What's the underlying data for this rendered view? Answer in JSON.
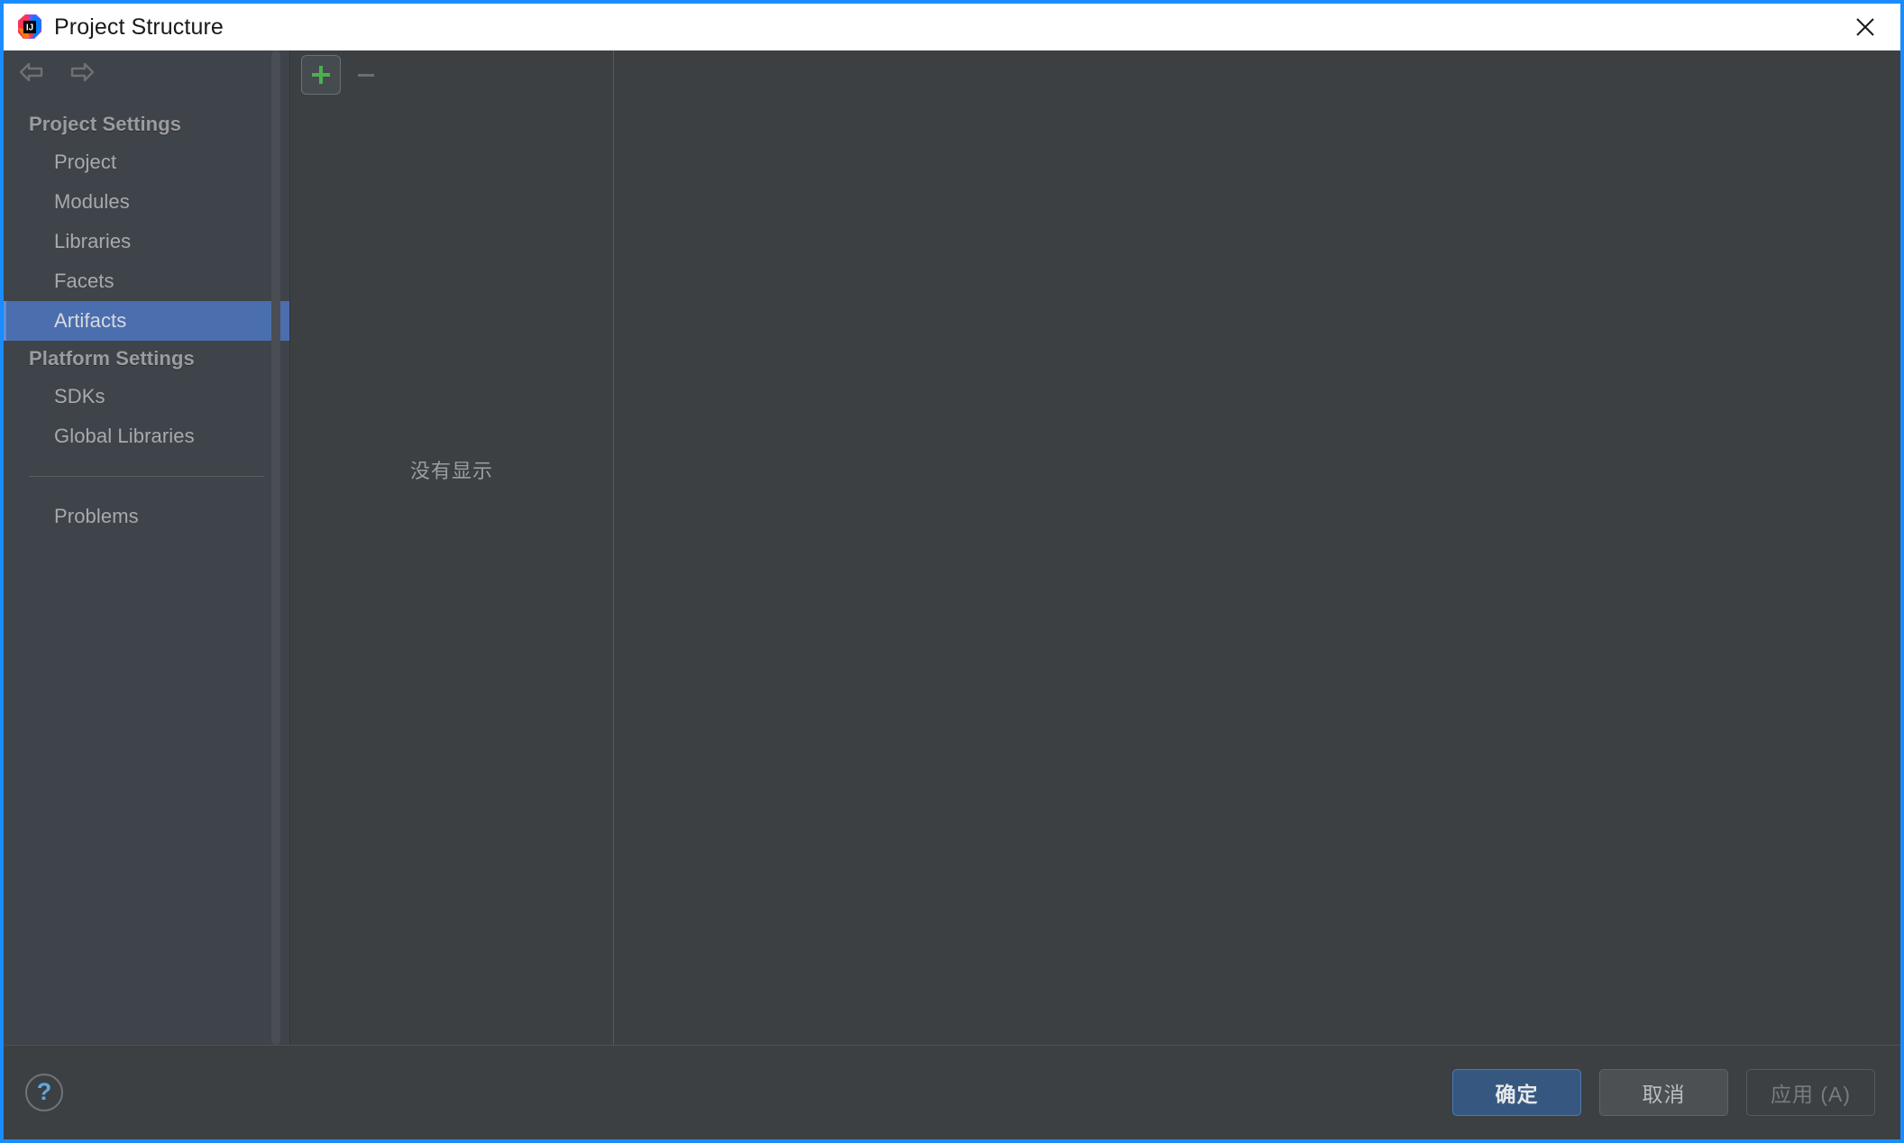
{
  "window": {
    "title": "Project Structure",
    "logo_icon": "intellij-idea-logo",
    "close_icon": "close-icon",
    "border_color": "#1a8cff",
    "titlebar_background": "#ffffff"
  },
  "nav": {
    "back_icon": "arrow-left-icon",
    "forward_icon": "arrow-right-icon"
  },
  "sidebar": {
    "background": "#3f434a",
    "selection_color": "#4b6eaf",
    "groups": [
      {
        "label": "Project Settings",
        "items": [
          {
            "label": "Project",
            "selected": false
          },
          {
            "label": "Modules",
            "selected": false
          },
          {
            "label": "Libraries",
            "selected": false
          },
          {
            "label": "Facets",
            "selected": false
          },
          {
            "label": "Artifacts",
            "selected": true
          }
        ]
      },
      {
        "label": "Platform Settings",
        "items": [
          {
            "label": "SDKs",
            "selected": false
          },
          {
            "label": "Global Libraries",
            "selected": false
          }
        ]
      }
    ],
    "extra_items": [
      {
        "label": "Problems"
      }
    ]
  },
  "toolbar": {
    "add_icon": "plus-icon",
    "add_label": "+",
    "add_color": "#4caf50",
    "remove_icon": "minus-icon",
    "remove_label": "—",
    "remove_enabled": false
  },
  "list_panel": {
    "empty_message": "没有显示"
  },
  "footer": {
    "help_icon": "help-icon",
    "help_label": "?",
    "buttons": [
      {
        "label": "确定",
        "style": "primary"
      },
      {
        "label": "取消",
        "style": "normal"
      },
      {
        "label": "应用 (A)",
        "style": "disabled"
      }
    ]
  }
}
